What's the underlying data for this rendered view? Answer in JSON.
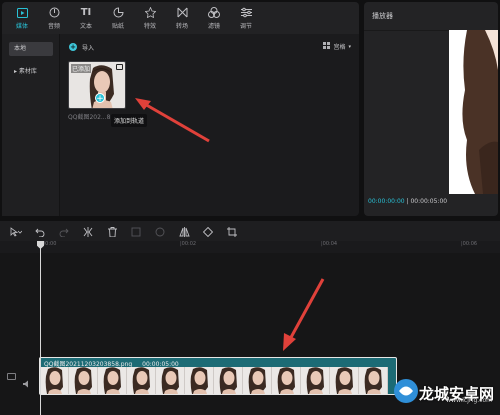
{
  "media_tabs": [
    {
      "label": "媒体",
      "icon": "media-icon",
      "active": true
    },
    {
      "label": "音频",
      "icon": "audio-icon",
      "active": false
    },
    {
      "label": "文本",
      "icon": "text-icon",
      "active": false
    },
    {
      "label": "贴纸",
      "icon": "sticker-icon",
      "active": false
    },
    {
      "label": "特效",
      "icon": "effects-icon",
      "active": false
    },
    {
      "label": "转场",
      "icon": "transition-icon",
      "active": false
    },
    {
      "label": "滤镜",
      "icon": "filter-icon",
      "active": false
    },
    {
      "label": "调节",
      "icon": "adjust-icon",
      "active": false
    }
  ],
  "sidebar": {
    "local": "本地",
    "library": "▸ 素材库"
  },
  "content": {
    "import": "导入",
    "view": "宫格",
    "thumb_tag": "已添加",
    "thumb_name": "QQ截图202...8",
    "tooltip": "添加到轨道"
  },
  "player": {
    "title": "播放器",
    "current_time": "00:00:00:00",
    "total_time": "00:00:05:00"
  },
  "ruler": {
    "ticks": [
      "00:00",
      "|00:02",
      "|00:04",
      "|00:06"
    ]
  },
  "clip": {
    "filename": "QQ截图20211203203858.png",
    "duration": "00:00:05:00"
  },
  "watermark": {
    "text": "龙城安卓网",
    "url": "www.lcjrfg.com"
  },
  "colors": {
    "accent": "#29c1d6",
    "arrow": "#e0413a"
  }
}
